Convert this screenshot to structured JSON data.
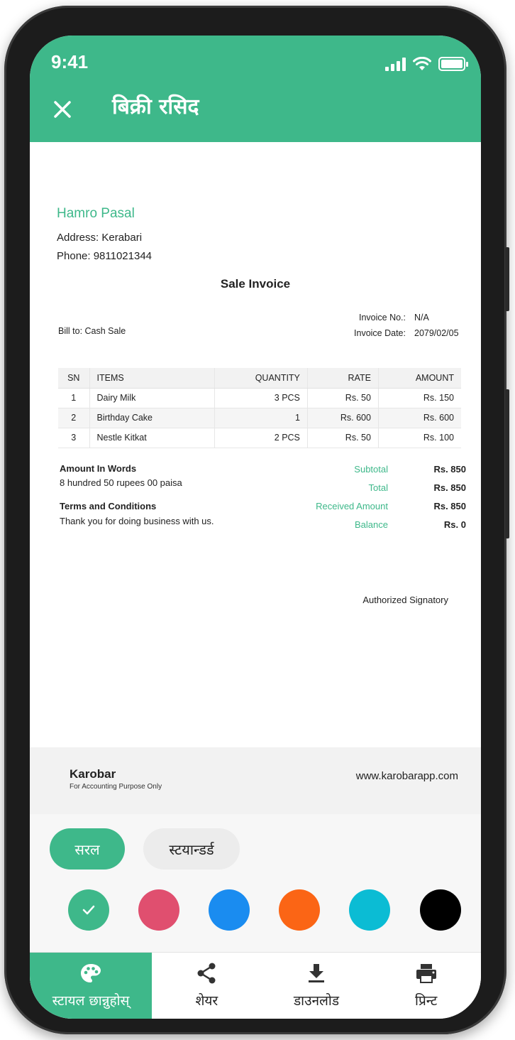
{
  "status": {
    "time": "9:41"
  },
  "header": {
    "title": "बिक्री रसिद"
  },
  "invoice": {
    "shop_name": "Hamro Pasal",
    "address": "Address: Kerabari",
    "phone": "Phone: 9811021344",
    "title": "Sale Invoice",
    "bill_to": "Bill to: Cash Sale",
    "invoice_no_label": "Invoice No.:",
    "invoice_no": "N/A",
    "invoice_date_label": "Invoice Date:",
    "invoice_date": "2079/02/05",
    "columns": [
      "SN",
      "ITEMS",
      "QUANTITY",
      "RATE",
      "AMOUNT"
    ],
    "rows": [
      [
        "1",
        "Dairy Milk",
        "3 PCS",
        "Rs. 50",
        "Rs. 150"
      ],
      [
        "2",
        "Birthday Cake",
        "1",
        "Rs. 600",
        "Rs. 600"
      ],
      [
        "3",
        "Nestle Kitkat",
        "2 PCS",
        "Rs. 50",
        "Rs. 100"
      ]
    ],
    "amount_words_label": "Amount In Words",
    "amount_words": "8 hundred 50 rupees 00 paisa",
    "terms_label": "Terms and Conditions",
    "terms": "Thank you for doing business with us.",
    "totals": [
      {
        "label": "Subtotal",
        "value": "Rs. 850"
      },
      {
        "label": "Total",
        "value": "Rs. 850"
      },
      {
        "label": "Received Amount",
        "value": "Rs. 850"
      },
      {
        "label": "Balance",
        "value": "Rs. 0"
      }
    ],
    "signatory": "Authorized Signatory",
    "footer_brand_k": "K",
    "footer_brand_rest": "arobar",
    "footer_tagline": "For Accounting Purpose Only",
    "footer_website": "www.karobarapp.com"
  },
  "styles": {
    "simple_label": "सरल",
    "standard_label": "स्टयान्डर्ड",
    "swatches": [
      "#3eb88a",
      "#e04f6f",
      "#1a8cf0",
      "#fb6515",
      "#0bbcd4",
      "#000000"
    ],
    "selected_swatch": 0
  },
  "nav": {
    "style_label": "स्टायल छान्नुहोस्",
    "share_label": "शेयर",
    "download_label": "डाउनलोड",
    "print_label": "प्रिन्ट"
  },
  "colors": {
    "accent": "#3eb88a"
  }
}
